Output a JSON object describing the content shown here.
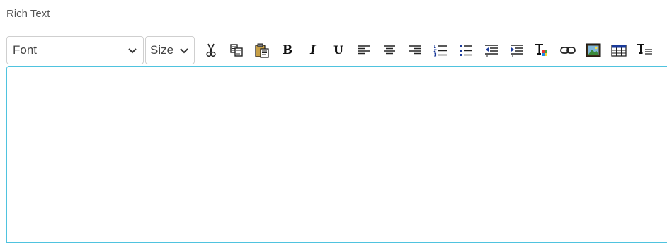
{
  "field": {
    "label": "Rich Text"
  },
  "toolbar": {
    "font_select": {
      "value": "Font"
    },
    "size_select": {
      "value": "Size"
    },
    "buttons": [
      {
        "name": "cut-icon"
      },
      {
        "name": "copy-icon"
      },
      {
        "name": "paste-icon"
      },
      {
        "name": "bold-icon",
        "glyph": "B"
      },
      {
        "name": "italic-icon",
        "glyph": "I"
      },
      {
        "name": "underline-icon",
        "glyph": "U"
      },
      {
        "name": "align-left-icon"
      },
      {
        "name": "align-center-icon"
      },
      {
        "name": "align-right-icon"
      },
      {
        "name": "ordered-list-icon"
      },
      {
        "name": "unordered-list-icon"
      },
      {
        "name": "outdent-icon"
      },
      {
        "name": "indent-icon"
      },
      {
        "name": "text-color-icon"
      },
      {
        "name": "link-icon"
      },
      {
        "name": "image-icon"
      },
      {
        "name": "table-icon"
      },
      {
        "name": "text-format-icon"
      }
    ]
  },
  "editor": {
    "content": ""
  },
  "colors": {
    "editor_border": "#4fc3df",
    "label": "#555555",
    "select_border": "#cfcfcf"
  }
}
